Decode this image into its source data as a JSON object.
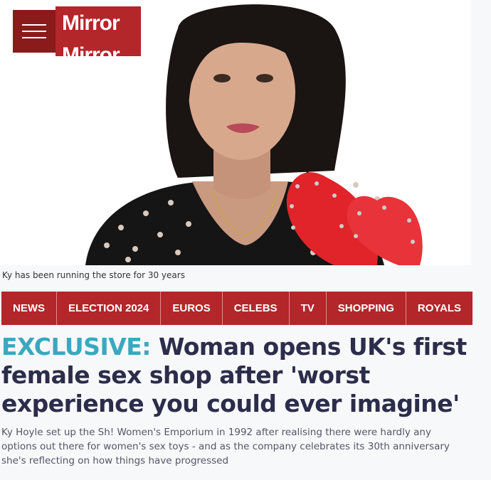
{
  "header": {
    "logo_text": "Mirror",
    "logo_text_echo": "Mirror",
    "menu_icon": "hamburger-icon"
  },
  "hero": {
    "image_subject": "woman-with-red-heart-paddle",
    "caption": "Ky has been running the store for 30 years"
  },
  "nav": {
    "items": [
      {
        "label": "NEWS"
      },
      {
        "label": "ELECTION 2024"
      },
      {
        "label": "EUROS"
      },
      {
        "label": "CELEBS"
      },
      {
        "label": "TV"
      },
      {
        "label": "SHOPPING"
      },
      {
        "label": "ROYALS"
      }
    ]
  },
  "article": {
    "kicker": "EXCLUSIVE:",
    "headline": "Woman opens UK's first female sex shop after 'worst experience you could ever imagine'",
    "standfirst": "Ky Hoyle set up the Sh! Women's Emporium in 1992 after realising there were hardly any options out there for women's sex toys - and as the company celebrates its 30th anniversary she's reflecting on how things have progressed"
  },
  "colors": {
    "brand_red": "#b3262a",
    "menu_dark_red": "#8b1a1a",
    "kicker_teal": "#3aa8bf",
    "headline_navy": "#2b2d4a"
  }
}
